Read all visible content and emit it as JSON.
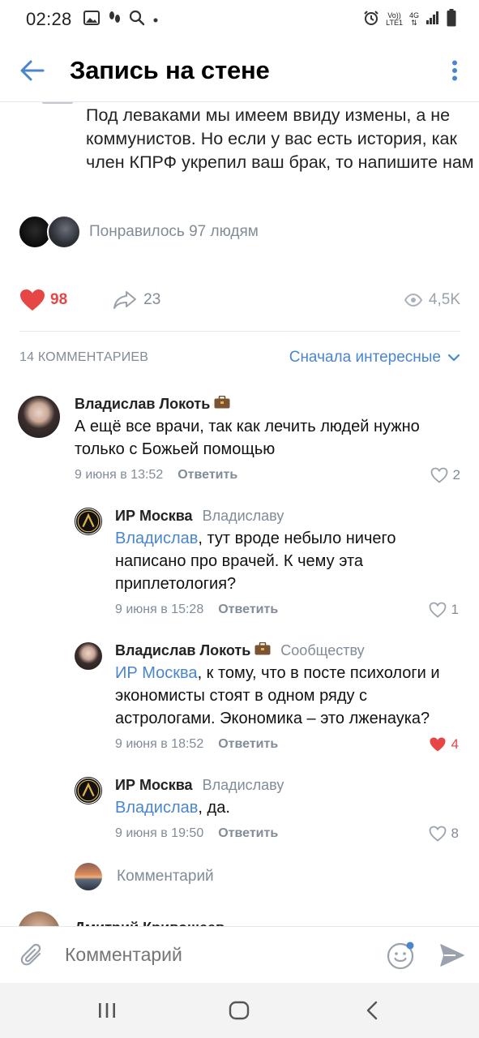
{
  "status_bar": {
    "time": "02:28",
    "net_top": "Vo))",
    "net_bottom": "LTE1",
    "signal_type": "4G"
  },
  "header": {
    "title": "Запись на стене"
  },
  "post": {
    "text": "Под леваками мы имеем ввиду измены, а не коммунистов. Но если у вас есть история, как член КПРФ укрепил ваш брак, то напишите нам",
    "liked_by": "Понравилось 97 людям",
    "likes": "98",
    "shares": "23",
    "views": "4,5K"
  },
  "comments_header": {
    "count_label": "14 КОММЕНТАРИЕВ",
    "sort_label": "Сначала интересные"
  },
  "comments": [
    {
      "author": "Владислав Локоть",
      "reply_to": "",
      "mention": "",
      "text": "А ещё все врачи, так как лечить людей нужно только с Божьей помощью",
      "date": "9 июня в 13:52",
      "reply_label": "Ответить",
      "likes": "2",
      "liked": false
    },
    {
      "author": "ИР Москва",
      "reply_to": "Владиславу",
      "mention": "Владислав",
      "text": ", тут вроде небыло ничего написано про врачей. К чему эта приплетология?",
      "date": "9 июня в 15:28",
      "reply_label": "Ответить",
      "likes": "1",
      "liked": false
    },
    {
      "author": "Владислав Локоть",
      "reply_to": "Сообществу",
      "mention": "ИР Москва",
      "text": ", к тому, что в посте психологи и экономисты стоят в одном ряду с астрологами. Экономика – это лженаука?",
      "date": "9 июня в 18:52",
      "reply_label": "Ответить",
      "likes": "4",
      "liked": true
    },
    {
      "author": "ИР Москва",
      "reply_to": "Владиславу",
      "mention": "Владислав",
      "text": ", да.",
      "date": "9 июня в 19:50",
      "reply_label": "Ответить",
      "likes": "8",
      "liked": false
    }
  ],
  "thread_compose": {
    "placeholder": "Комментарий"
  },
  "next_comment": {
    "author": "Дмитрий Кривошеев"
  },
  "compose": {
    "placeholder": "Комментарий"
  },
  "colors": {
    "accent": "#4986cc",
    "like_red": "#e64646",
    "secondary_text": "#818c99",
    "divider": "#e7e8ec",
    "nav_bg": "#f3f3f3"
  },
  "icons": {
    "back": "arrow-left-icon",
    "more": "more-vertical-icon",
    "like": "heart-icon",
    "share": "share-icon",
    "views": "eye-icon",
    "sort": "chevron-down-icon",
    "attach": "paperclip-icon",
    "emoji": "smile-icon",
    "send": "send-icon"
  }
}
